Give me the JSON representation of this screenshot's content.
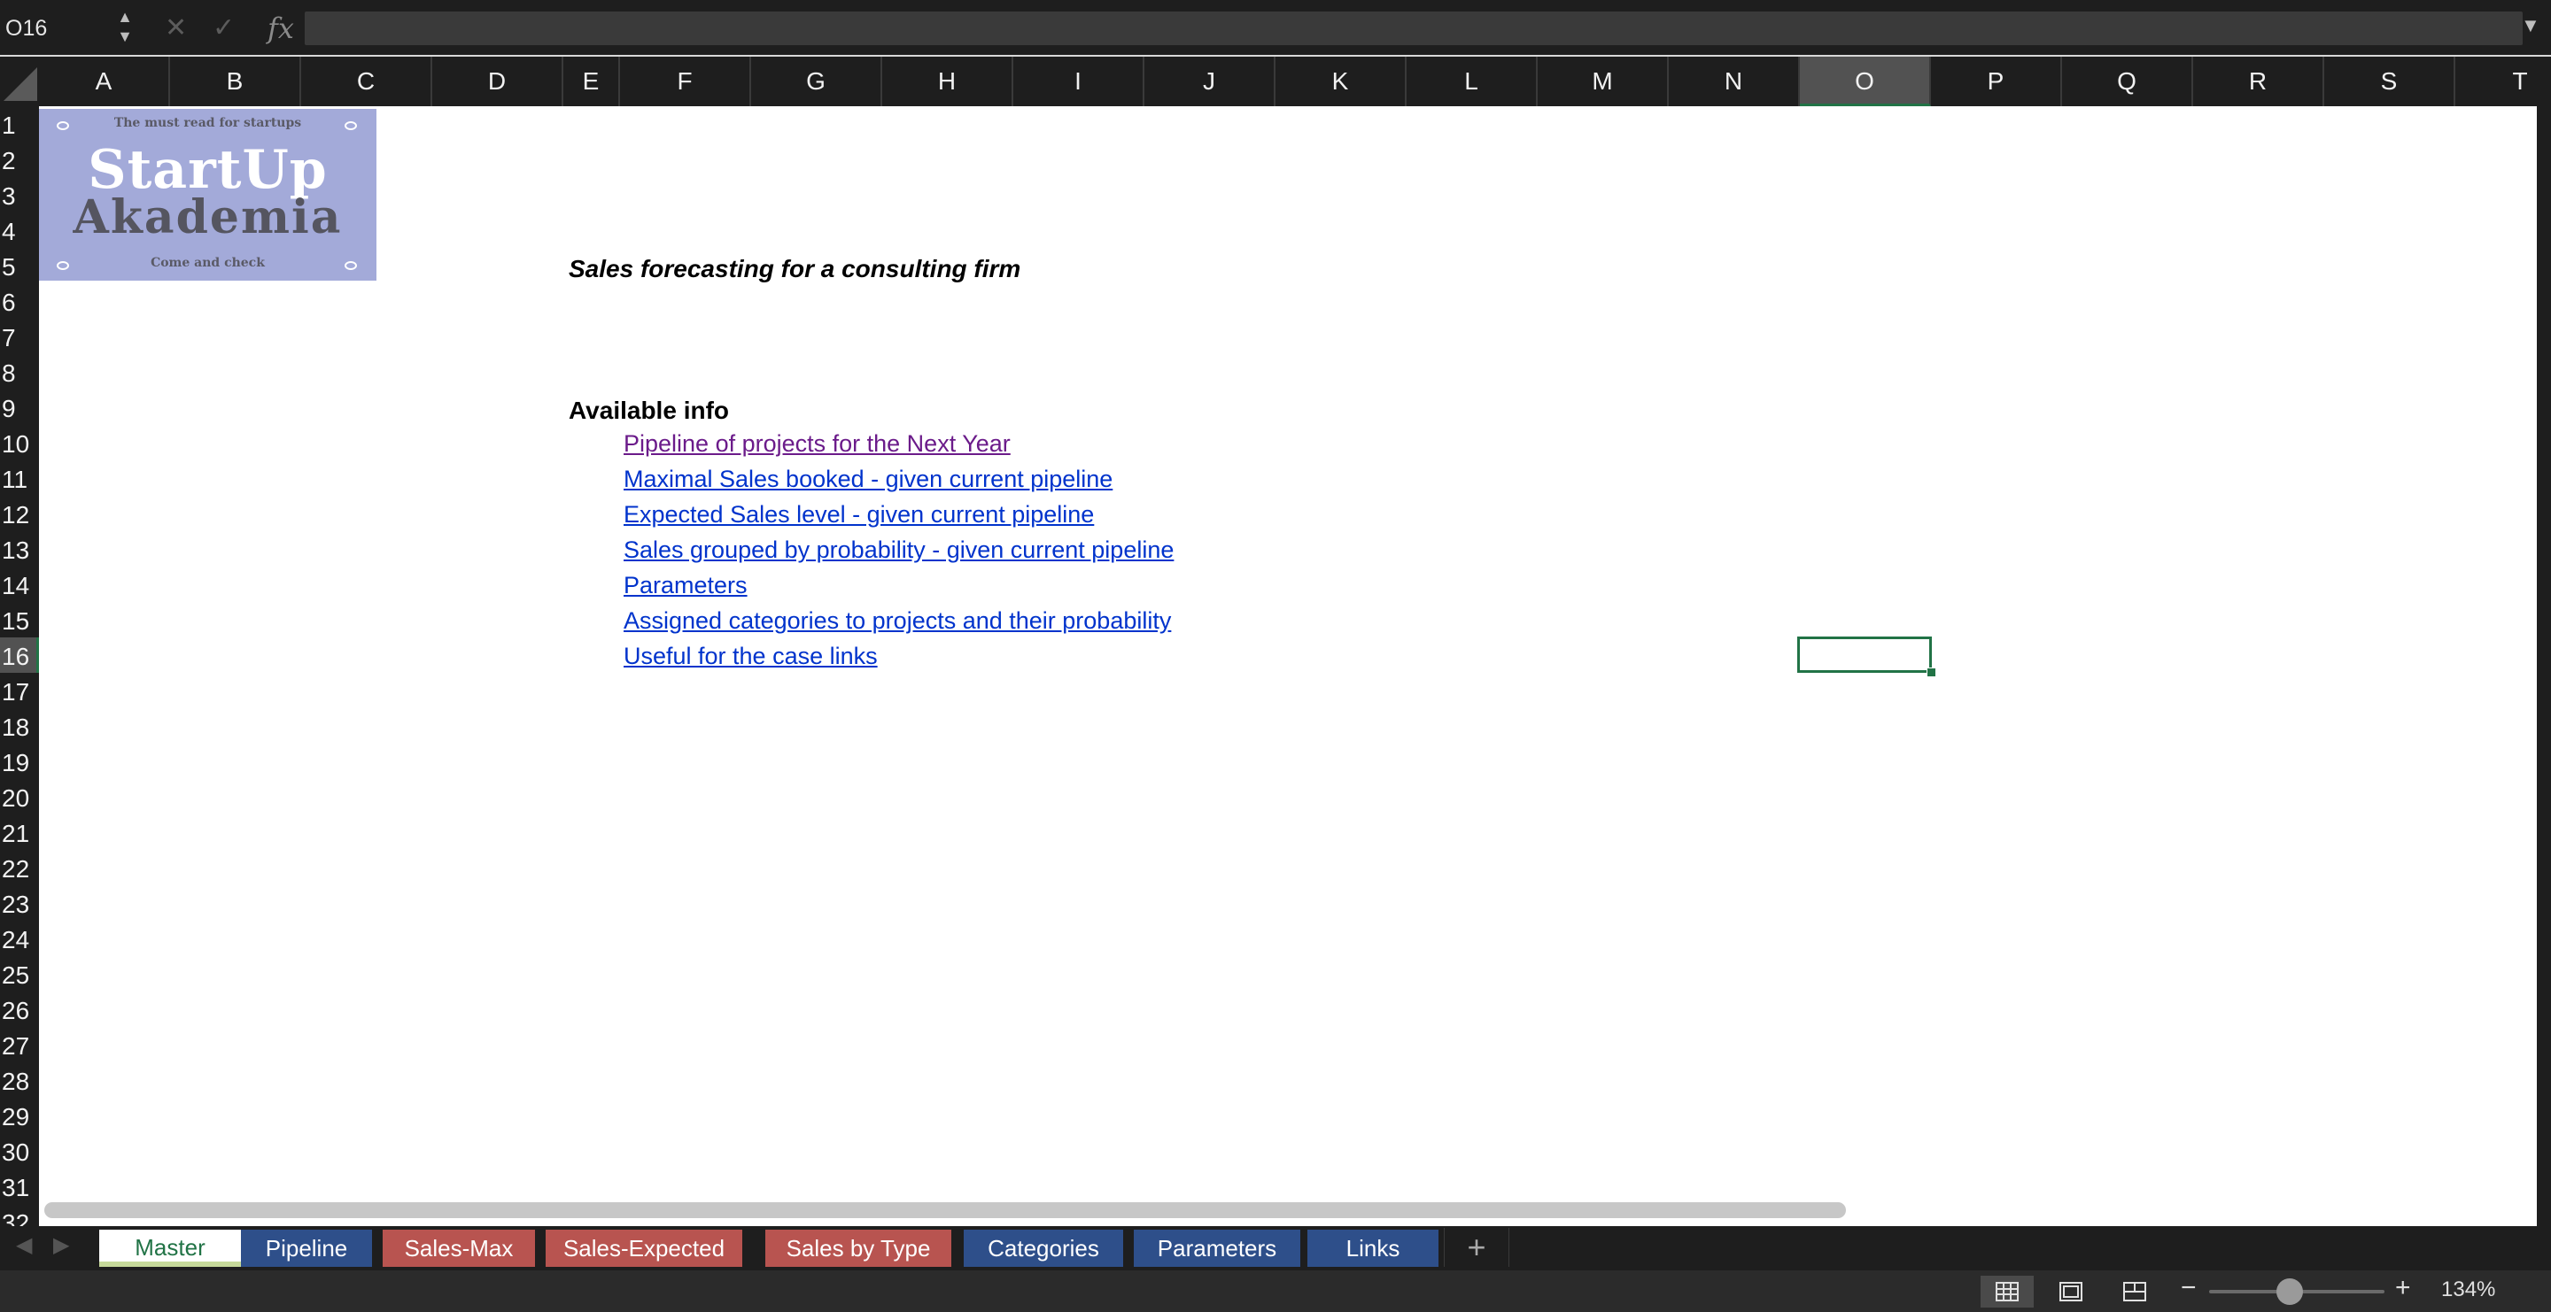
{
  "formula_bar": {
    "name_box": "O16",
    "formula": "",
    "cancel_icon": "close-icon",
    "enter_icon": "check-icon",
    "fx_label": "fx"
  },
  "columns": [
    "A",
    "B",
    "C",
    "D",
    "E",
    "F",
    "G",
    "H",
    "I",
    "J",
    "K",
    "L",
    "M",
    "N",
    "O",
    "P",
    "Q",
    "R",
    "S",
    "T"
  ],
  "rows": [
    "1",
    "2",
    "3",
    "4",
    "5",
    "6",
    "7",
    "8",
    "9",
    "10",
    "11",
    "12",
    "13",
    "14",
    "15",
    "16",
    "17",
    "18",
    "19",
    "20",
    "21",
    "22",
    "23",
    "24",
    "25",
    "26",
    "27",
    "28",
    "29",
    "30",
    "31",
    "32"
  ],
  "selected": {
    "column": "O",
    "row": "16"
  },
  "logo": {
    "tagline_top": "The must read for startups",
    "line1": "StartUp",
    "line2": "Akademia",
    "tagline_bottom": "Come and  check"
  },
  "sheet": {
    "title": "Sales forecasting for a consulting firm",
    "section_heading": "Available info",
    "links": [
      "Pipeline of projects for the Next Year",
      "Maximal Sales booked - given current pipeline",
      "Expected Sales level - given current pipeline",
      "Sales grouped by probability - given current pipeline",
      "Parameters",
      "Assigned categories to projects and their probability",
      "Useful for the case links"
    ]
  },
  "tabs": [
    {
      "label": "Master",
      "color": "#ffffff",
      "text_color": "#217346",
      "active": true
    },
    {
      "label": "Pipeline",
      "color": "#2e4f8a",
      "text_color": "#ffffff",
      "active": false
    },
    {
      "label": "Sales-Max",
      "color": "#b85450",
      "text_color": "#ffffff",
      "active": false
    },
    {
      "label": "Sales-Expected",
      "color": "#b85450",
      "text_color": "#ffffff",
      "active": false
    },
    {
      "label": "Sales by Type",
      "color": "#b85450",
      "text_color": "#ffffff",
      "active": false
    },
    {
      "label": "Categories",
      "color": "#2e4f8a",
      "text_color": "#ffffff",
      "active": false
    },
    {
      "label": "Parameters",
      "color": "#2e4f8a",
      "text_color": "#ffffff",
      "active": false
    },
    {
      "label": "Links",
      "color": "#2e4f8a",
      "text_color": "#ffffff",
      "active": false
    }
  ],
  "status_bar": {
    "zoom_level": "134%",
    "zoom_fraction": 0.46,
    "view_modes": [
      "normal-view-icon",
      "page-layout-icon",
      "page-break-icon"
    ]
  }
}
